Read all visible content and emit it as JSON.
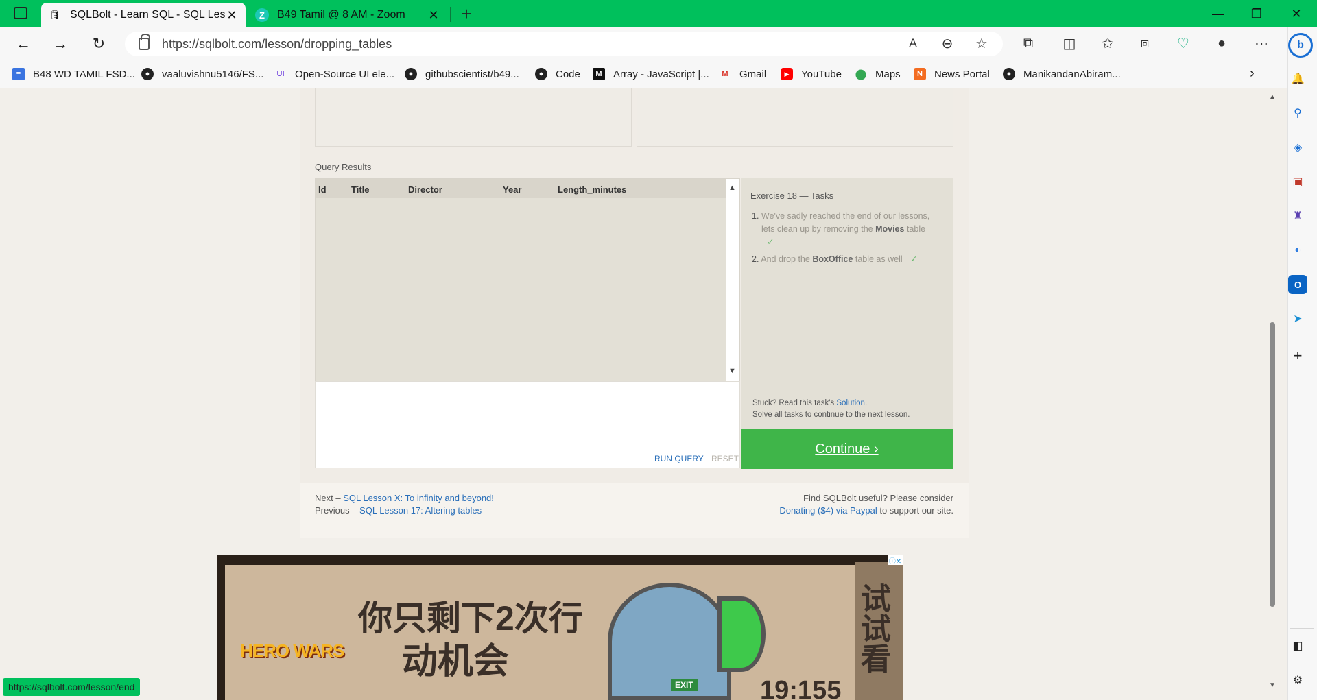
{
  "browser": {
    "tabs": [
      {
        "title": "SQLBolt - Learn SQL - SQL Lesson",
        "active": true,
        "icon": "database-icon"
      },
      {
        "title": "B49 Tamil @ 8 AM - Zoom",
        "active": false,
        "icon": "zoom-icon"
      }
    ],
    "url": "https://sqlbolt.com/lesson/dropping_tables",
    "bookmarks": [
      {
        "label": "B48 WD TAMIL FSD...",
        "icon": "docs-icon"
      },
      {
        "label": "vaaluvishnu5146/FS...",
        "icon": "github-icon"
      },
      {
        "label": "Open-Source UI ele...",
        "icon": "ui-icon"
      },
      {
        "label": "githubscientist/b49...",
        "icon": "github-icon"
      },
      {
        "label": "Code",
        "icon": "github-icon"
      },
      {
        "label": "Array - JavaScript |...",
        "icon": "mdn-icon"
      },
      {
        "label": "Gmail",
        "icon": "gmail-icon"
      },
      {
        "label": "YouTube",
        "icon": "youtube-icon"
      },
      {
        "label": "Maps",
        "icon": "maps-icon"
      },
      {
        "label": "News Portal",
        "icon": "news-icon"
      },
      {
        "label": "ManikandanAbiram...",
        "icon": "github-icon"
      }
    ],
    "status_url": "https://sqlbolt.com/lesson/end",
    "accent": "#00c05c"
  },
  "lesson": {
    "query_results_label": "Query Results",
    "columns": [
      "Id",
      "Title",
      "Director",
      "Year",
      "Length_minutes"
    ],
    "run_query": "RUN QUERY",
    "reset": "RESET",
    "exercise_title": "Exercise 18 — Tasks",
    "task1_a": "We've sadly reached the end of our lessons,",
    "task1_b": "lets clean up by removing the",
    "task1_bold": "Movies",
    "task1_c": "table",
    "task2_a": "And drop the",
    "task2_bold": "BoxOffice",
    "task2_c": "table as well",
    "check": "✓",
    "stuck_text": "Stuck? Read this task's",
    "solution_link": "Solution",
    "solve_all": "Solve all tasks to continue to the next lesson.",
    "continue": "Continue ›",
    "next_label": "Next –",
    "next_link": "SQL Lesson X: To infinity and beyond!",
    "prev_label": "Previous –",
    "prev_link": "SQL Lesson 17: Altering tables",
    "useful_text": "Find SQLBolt useful? Please consider",
    "donate_link": "Donating ($4) via Paypal",
    "support_text": "to support our site."
  },
  "ad": {
    "brand": "HERO WARS",
    "headline_1": "你只剩下2次行",
    "headline_2": "动机会",
    "side_text": "试试看",
    "exit": "EXIT",
    "timer": "19:155"
  }
}
